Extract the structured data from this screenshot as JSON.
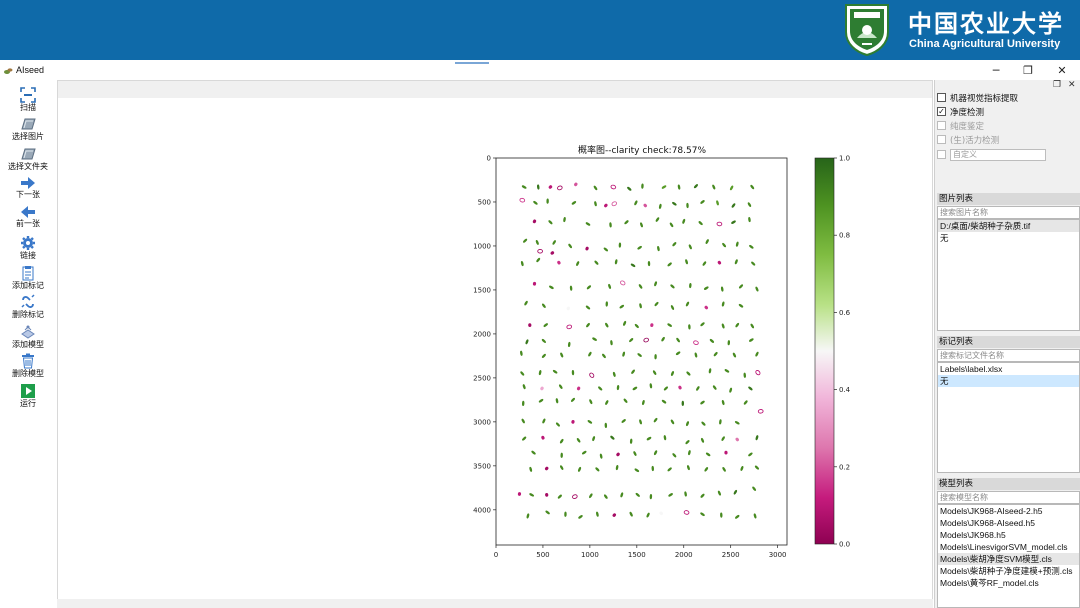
{
  "banner": {
    "name_cn": "中国农业大学",
    "name_en": "China Agricultural University",
    "brand_color": "#0f6aa9"
  },
  "window": {
    "title": "AIseed",
    "minimize": "─",
    "maximize": "❐",
    "close": "✕"
  },
  "toolbar": [
    {
      "label": "扫描",
      "icon": "scan-icon"
    },
    {
      "label": "选择图片",
      "icon": "image-icon"
    },
    {
      "label": "选择文件夹",
      "icon": "folder-icon"
    },
    {
      "label": "下一张",
      "icon": "arrow-right-icon"
    },
    {
      "label": "前一张",
      "icon": "arrow-left-icon"
    },
    {
      "label": "链接",
      "icon": "gear-icon"
    },
    {
      "label": "添加标记",
      "icon": "add-label-icon"
    },
    {
      "label": "删除标记",
      "icon": "delete-label-icon"
    },
    {
      "label": "添加模型",
      "icon": "add-model-icon"
    },
    {
      "label": "删除模型",
      "icon": "trash-icon"
    },
    {
      "label": "运行",
      "icon": "play-icon"
    }
  ],
  "right_panel": {
    "float_btn": "❐",
    "close_btn": "✕",
    "options": [
      {
        "label": "机器视觉指标提取",
        "checked": false,
        "enabled": true
      },
      {
        "label": "净度检测",
        "checked": true,
        "enabled": true
      },
      {
        "label": "纯度鉴定",
        "checked": false,
        "enabled": false
      },
      {
        "label": "(生)活力检测",
        "checked": false,
        "enabled": false
      },
      {
        "label": "",
        "checked": false,
        "enabled": false
      }
    ],
    "custom_placeholder": "自定义",
    "image_list": {
      "title": "图片列表",
      "search_placeholder": "搜索图片名称",
      "items": [
        "D:/桌面/柴胡种子杂质.tif",
        "无"
      ]
    },
    "label_list": {
      "title": "标记列表",
      "search_placeholder": "搜索标记文件名称",
      "items": [
        "Labels\\label.xlsx",
        "无"
      ]
    },
    "model_list": {
      "title": "模型列表",
      "search_placeholder": "搜索模型名称",
      "items": [
        "Models\\JK968-AIseed-2.h5",
        "Models\\JK968-AIseed.h5",
        "Models\\JK968.h5",
        "Models\\LinesvigorSVM_model.cls",
        "Models\\柴胡净度SVM模型.cls",
        "Models\\柴胡种子净度建模+预测.cls",
        "Models\\黄芩RF_model.cls"
      ]
    }
  },
  "chart_data": {
    "type": "scatter",
    "title": "概率图--clarity check:78.57%",
    "xlim": [
      0,
      3100
    ],
    "ylim": [
      4400,
      0
    ],
    "x_ticks": [
      "0",
      "500",
      "1000",
      "1500",
      "2000",
      "2500",
      "3000"
    ],
    "y_ticks": [
      "0",
      "500",
      "1000",
      "1500",
      "2000",
      "2500",
      "3000",
      "3500",
      "4000"
    ],
    "colorbar": {
      "min": 0.0,
      "max": 1.0,
      "ticks": [
        "0.0",
        "0.2",
        "0.4",
        "0.6",
        "0.8",
        "1.0"
      ],
      "colormap": "PiYG",
      "low_color": "#8e0152",
      "mid_color": "#f7f7f7",
      "high_color": "#276419"
    },
    "points": [
      [
        300,
        330,
        0.9
      ],
      [
        450,
        330,
        0.95
      ],
      [
        580,
        330,
        0.1
      ],
      [
        680,
        340,
        0.05
      ],
      [
        850,
        300,
        0.2
      ],
      [
        1060,
        340,
        0.9
      ],
      [
        1250,
        330,
        0.1
      ],
      [
        1420,
        350,
        0.95
      ],
      [
        1560,
        320,
        0.9
      ],
      [
        1790,
        330,
        0.85
      ],
      [
        1950,
        330,
        0.9
      ],
      [
        2130,
        320,
        0.95
      ],
      [
        2320,
        330,
        0.9
      ],
      [
        2510,
        340,
        0.85
      ],
      [
        2730,
        330,
        0.9
      ],
      [
        280,
        480,
        0.15
      ],
      [
        420,
        510,
        0.9
      ],
      [
        550,
        490,
        0.9
      ],
      [
        830,
        510,
        0.9
      ],
      [
        1060,
        520,
        0.9
      ],
      [
        1170,
        540,
        0.1
      ],
      [
        1260,
        520,
        0.2
      ],
      [
        1490,
        510,
        0.9
      ],
      [
        1590,
        540,
        0.2
      ],
      [
        1750,
        550,
        0.9
      ],
      [
        1900,
        520,
        0.95
      ],
      [
        2040,
        540,
        0.9
      ],
      [
        2200,
        500,
        0.9
      ],
      [
        2360,
        510,
        0.85
      ],
      [
        2530,
        540,
        0.95
      ],
      [
        2700,
        530,
        0.9
      ],
      [
        410,
        720,
        0.05
      ],
      [
        580,
        730,
        0.9
      ],
      [
        730,
        700,
        0.9
      ],
      [
        980,
        750,
        0.9
      ],
      [
        1220,
        760,
        0.9
      ],
      [
        1390,
        730,
        0.9
      ],
      [
        1550,
        760,
        0.9
      ],
      [
        1720,
        700,
        0.9
      ],
      [
        1870,
        760,
        0.9
      ],
      [
        2000,
        720,
        0.9
      ],
      [
        2180,
        740,
        0.9
      ],
      [
        2380,
        750,
        0.1
      ],
      [
        2530,
        730,
        0.95
      ],
      [
        2700,
        700,
        0.9
      ],
      [
        310,
        940,
        0.9
      ],
      [
        440,
        960,
        0.9
      ],
      [
        620,
        960,
        0.9
      ],
      [
        790,
        1000,
        0.9
      ],
      [
        970,
        1030,
        0.05
      ],
      [
        1170,
        1040,
        0.9
      ],
      [
        1320,
        990,
        0.9
      ],
      [
        1530,
        1020,
        0.9
      ],
      [
        1730,
        1030,
        0.9
      ],
      [
        1900,
        980,
        0.9
      ],
      [
        2070,
        1010,
        0.9
      ],
      [
        2250,
        950,
        0.9
      ],
      [
        2430,
        990,
        0.9
      ],
      [
        2570,
        980,
        0.9
      ],
      [
        2720,
        1010,
        0.9
      ],
      [
        470,
        1060,
        0.05
      ],
      [
        600,
        1080,
        0.05
      ],
      [
        280,
        1200,
        0.9
      ],
      [
        450,
        1160,
        0.9
      ],
      [
        670,
        1190,
        0.15
      ],
      [
        870,
        1200,
        0.9
      ],
      [
        1070,
        1190,
        0.9
      ],
      [
        1280,
        1180,
        0.9
      ],
      [
        1460,
        1220,
        0.95
      ],
      [
        1630,
        1200,
        0.9
      ],
      [
        1850,
        1210,
        0.9
      ],
      [
        2030,
        1180,
        0.9
      ],
      [
        2220,
        1200,
        0.9
      ],
      [
        2380,
        1190,
        0.1
      ],
      [
        2560,
        1180,
        0.9
      ],
      [
        2740,
        1200,
        0.9
      ],
      [
        410,
        1430,
        0.1
      ],
      [
        590,
        1470,
        0.9
      ],
      [
        800,
        1480,
        0.9
      ],
      [
        990,
        1470,
        0.9
      ],
      [
        1210,
        1460,
        0.9
      ],
      [
        1350,
        1420,
        0.2
      ],
      [
        1540,
        1460,
        0.9
      ],
      [
        1700,
        1430,
        0.9
      ],
      [
        1880,
        1460,
        0.9
      ],
      [
        2070,
        1450,
        0.9
      ],
      [
        2240,
        1480,
        0.9
      ],
      [
        2410,
        1490,
        0.9
      ],
      [
        2610,
        1460,
        0.9
      ],
      [
        2780,
        1490,
        0.9
      ],
      [
        320,
        1650,
        0.9
      ],
      [
        510,
        1680,
        0.9
      ],
      [
        770,
        1710,
        0.5
      ],
      [
        980,
        1700,
        0.9
      ],
      [
        1180,
        1660,
        0.9
      ],
      [
        1340,
        1690,
        0.9
      ],
      [
        1540,
        1680,
        0.9
      ],
      [
        1710,
        1660,
        0.9
      ],
      [
        1880,
        1700,
        0.9
      ],
      [
        2040,
        1660,
        0.9
      ],
      [
        2240,
        1700,
        0.15
      ],
      [
        2420,
        1660,
        0.9
      ],
      [
        2610,
        1680,
        0.9
      ],
      [
        360,
        1900,
        0.05
      ],
      [
        530,
        1900,
        0.9
      ],
      [
        780,
        1920,
        0.1
      ],
      [
        980,
        1900,
        0.9
      ],
      [
        1180,
        1900,
        0.9
      ],
      [
        1370,
        1880,
        0.9
      ],
      [
        1500,
        1910,
        0.9
      ],
      [
        1660,
        1900,
        0.15
      ],
      [
        1850,
        1900,
        0.9
      ],
      [
        2060,
        1920,
        0.9
      ],
      [
        2200,
        1890,
        0.9
      ],
      [
        2420,
        1910,
        0.9
      ],
      [
        2570,
        1900,
        0.9
      ],
      [
        2730,
        1910,
        0.9
      ],
      [
        330,
        2090,
        0.95
      ],
      [
        510,
        2080,
        0.9
      ],
      [
        780,
        2120,
        0.9
      ],
      [
        1050,
        2060,
        0.9
      ],
      [
        1230,
        2100,
        0.9
      ],
      [
        1440,
        2070,
        0.9
      ],
      [
        1600,
        2070,
        0.02
      ],
      [
        1780,
        2060,
        0.9
      ],
      [
        1940,
        2070,
        0.9
      ],
      [
        2130,
        2100,
        0.15
      ],
      [
        2300,
        2080,
        0.9
      ],
      [
        2480,
        2100,
        0.9
      ],
      [
        2720,
        2070,
        0.9
      ],
      [
        270,
        2220,
        0.9
      ],
      [
        510,
        2250,
        0.9
      ],
      [
        700,
        2240,
        0.9
      ],
      [
        1000,
        2230,
        0.9
      ],
      [
        1150,
        2250,
        0.9
      ],
      [
        1360,
        2230,
        0.9
      ],
      [
        1530,
        2240,
        0.9
      ],
      [
        1700,
        2260,
        0.9
      ],
      [
        1940,
        2220,
        0.9
      ],
      [
        2130,
        2240,
        0.9
      ],
      [
        2340,
        2230,
        0.9
      ],
      [
        2540,
        2240,
        0.9
      ],
      [
        2780,
        2230,
        0.9
      ],
      [
        280,
        2450,
        0.9
      ],
      [
        470,
        2440,
        0.9
      ],
      [
        630,
        2430,
        0.9
      ],
      [
        820,
        2440,
        0.9
      ],
      [
        1020,
        2470,
        0.05
      ],
      [
        1260,
        2460,
        0.9
      ],
      [
        1460,
        2430,
        0.9
      ],
      [
        1690,
        2440,
        0.9
      ],
      [
        1880,
        2450,
        0.9
      ],
      [
        2050,
        2450,
        0.9
      ],
      [
        2280,
        2420,
        0.9
      ],
      [
        2460,
        2420,
        0.9
      ],
      [
        2650,
        2470,
        0.9
      ],
      [
        2790,
        2440,
        0.1
      ],
      [
        300,
        2600,
        0.9
      ],
      [
        490,
        2620,
        0.35
      ],
      [
        690,
        2600,
        0.9
      ],
      [
        880,
        2620,
        0.15
      ],
      [
        1110,
        2620,
        0.9
      ],
      [
        1300,
        2610,
        0.9
      ],
      [
        1480,
        2620,
        0.9
      ],
      [
        1650,
        2590,
        0.9
      ],
      [
        1810,
        2620,
        0.9
      ],
      [
        1960,
        2610,
        0.15
      ],
      [
        2150,
        2620,
        0.9
      ],
      [
        2330,
        2610,
        0.9
      ],
      [
        2500,
        2640,
        0.9
      ],
      [
        2710,
        2620,
        0.95
      ],
      [
        290,
        2790,
        0.9
      ],
      [
        480,
        2760,
        0.9
      ],
      [
        650,
        2760,
        0.9
      ],
      [
        820,
        2750,
        0.9
      ],
      [
        1010,
        2770,
        0.9
      ],
      [
        1180,
        2780,
        0.9
      ],
      [
        1380,
        2760,
        0.9
      ],
      [
        1570,
        2780,
        0.9
      ],
      [
        1790,
        2770,
        0.9
      ],
      [
        1990,
        2790,
        0.95
      ],
      [
        2200,
        2780,
        0.9
      ],
      [
        2420,
        2780,
        0.9
      ],
      [
        2660,
        2780,
        0.9
      ],
      [
        290,
        2990,
        0.9
      ],
      [
        510,
        2990,
        0.9
      ],
      [
        660,
        3030,
        0.9
      ],
      [
        820,
        3000,
        0.1
      ],
      [
        1000,
        3000,
        0.9
      ],
      [
        1170,
        3040,
        0.9
      ],
      [
        1360,
        2990,
        0.9
      ],
      [
        1540,
        3000,
        0.9
      ],
      [
        1700,
        2980,
        0.9
      ],
      [
        1880,
        3000,
        0.9
      ],
      [
        2040,
        3020,
        0.9
      ],
      [
        2210,
        3020,
        0.9
      ],
      [
        2390,
        3000,
        0.9
      ],
      [
        2570,
        3010,
        0.9
      ],
      [
        2820,
        2880,
        0.1
      ],
      [
        300,
        3190,
        0.9
      ],
      [
        500,
        3180,
        0.1
      ],
      [
        700,
        3220,
        0.9
      ],
      [
        880,
        3210,
        0.9
      ],
      [
        1040,
        3190,
        0.9
      ],
      [
        1240,
        3180,
        0.95
      ],
      [
        1440,
        3220,
        0.9
      ],
      [
        1630,
        3190,
        0.9
      ],
      [
        1800,
        3180,
        0.9
      ],
      [
        2040,
        3230,
        0.9
      ],
      [
        2200,
        3210,
        0.9
      ],
      [
        2420,
        3190,
        0.9
      ],
      [
        2570,
        3200,
        0.25
      ],
      [
        2780,
        3180,
        0.95
      ],
      [
        400,
        3350,
        0.9
      ],
      [
        700,
        3380,
        0.9
      ],
      [
        940,
        3350,
        0.9
      ],
      [
        1120,
        3390,
        0.9
      ],
      [
        1300,
        3370,
        0.05
      ],
      [
        1480,
        3360,
        0.9
      ],
      [
        1700,
        3350,
        0.9
      ],
      [
        1900,
        3380,
        0.9
      ],
      [
        2060,
        3350,
        0.9
      ],
      [
        2260,
        3370,
        0.9
      ],
      [
        2450,
        3350,
        0.1
      ],
      [
        2710,
        3370,
        0.9
      ],
      [
        370,
        3540,
        0.9
      ],
      [
        540,
        3530,
        0.05
      ],
      [
        700,
        3520,
        0.9
      ],
      [
        890,
        3540,
        0.9
      ],
      [
        1080,
        3540,
        0.9
      ],
      [
        1290,
        3520,
        0.9
      ],
      [
        1500,
        3550,
        0.9
      ],
      [
        1670,
        3530,
        0.9
      ],
      [
        1850,
        3540,
        0.9
      ],
      [
        2050,
        3520,
        0.9
      ],
      [
        2240,
        3540,
        0.9
      ],
      [
        2430,
        3540,
        0.9
      ],
      [
        2620,
        3530,
        0.9
      ],
      [
        2780,
        3520,
        0.9
      ],
      [
        250,
        3820,
        0.1
      ],
      [
        380,
        3830,
        0.9
      ],
      [
        540,
        3830,
        0.05
      ],
      [
        680,
        3850,
        0.9
      ],
      [
        840,
        3850,
        0.05
      ],
      [
        1010,
        3840,
        0.9
      ],
      [
        1170,
        3850,
        0.9
      ],
      [
        1340,
        3830,
        0.9
      ],
      [
        1510,
        3830,
        0.9
      ],
      [
        1650,
        3850,
        0.9
      ],
      [
        1860,
        3830,
        0.9
      ],
      [
        2020,
        3820,
        0.9
      ],
      [
        2200,
        3840,
        0.9
      ],
      [
        2380,
        3810,
        0.9
      ],
      [
        2550,
        3800,
        0.95
      ],
      [
        2750,
        3760,
        0.9
      ],
      [
        340,
        4070,
        0.9
      ],
      [
        550,
        4030,
        0.9
      ],
      [
        740,
        4050,
        0.9
      ],
      [
        900,
        4080,
        0.9
      ],
      [
        1080,
        4050,
        0.9
      ],
      [
        1260,
        4060,
        0.05
      ],
      [
        1440,
        4050,
        0.9
      ],
      [
        1620,
        4060,
        0.9
      ],
      [
        1760,
        4040,
        0.5
      ],
      [
        2030,
        4030,
        0.1
      ],
      [
        2200,
        4050,
        0.9
      ],
      [
        2400,
        4060,
        0.9
      ],
      [
        2570,
        4080,
        0.9
      ],
      [
        2760,
        4070,
        0.9
      ]
    ]
  }
}
